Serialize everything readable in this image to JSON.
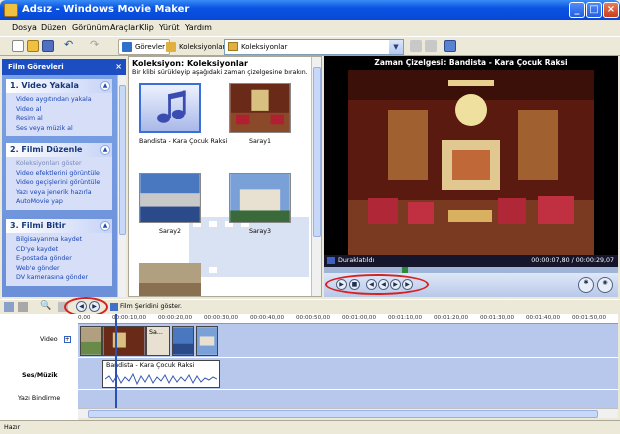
{
  "window": {
    "title": "Adsız - Windows Movie Maker"
  },
  "menu": [
    "Dosya",
    "Düzen",
    "Görünüm",
    "Araçlar",
    "Klip",
    "Yürüt",
    "Yardım"
  ],
  "toolbar": {
    "tasks_label": "Görevler",
    "collections_label": "Koleksiyonlar",
    "collections_combo": "Koleksiyonlar"
  },
  "taskpane": {
    "header": "Film Görevleri",
    "sections": [
      {
        "title": "1. Video Yakala",
        "items": [
          "Video aygıtından yakala",
          "Video al",
          "Resim al",
          "Ses veya müzik al"
        ]
      },
      {
        "title": "2. Filmi Düzenle",
        "items": [
          "Koleksiyonları göster",
          "Video efektlerini görüntüle",
          "Video geçişlerini görüntüle",
          "Yazı veya jenerik hazırla",
          "AutoMovie yap"
        ]
      },
      {
        "title": "3. Filmi Bitir",
        "items": [
          "Bilgisayarıma kaydet",
          "CD'ye kaydet",
          "E-postada gönder",
          "Web'e gönder",
          "DV kamerasına gönder"
        ]
      }
    ]
  },
  "collections": {
    "title": "Koleksiyon: Koleksiyonlar",
    "subtitle": "Bir klibi sürükleyip aşağıdaki zaman çizelgesine bırakın.",
    "clips": [
      "Bandista - Kara Çocuk Raksi",
      "Saray1",
      "Saray2",
      "Saray3"
    ]
  },
  "preview": {
    "title": "Zaman Çizelgesi: Bandista - Kara Çocuk Raksi",
    "status": "Duraklatıldı",
    "time": "00:00:07,80 / 00:00:29,07"
  },
  "timeline": {
    "show_storyboard": "Film Şeridini göster.",
    "ruler": [
      "0,00",
      "00:00:10,00",
      "00:00:20,00",
      "00:00:30,00",
      "00:00:40,00",
      "00:00:50,00",
      "00:01:00,00",
      "00:01:10,00",
      "00:01:20,00",
      "00:01:30,00",
      "00:01:40,00",
      "00:01:50,00"
    ],
    "tracks": {
      "video": "Video",
      "audio": "Ses/Müzik",
      "title_overlay": "Yazı Bindirme"
    },
    "video_clip_label": "Sa...",
    "audio_clip": "Bandista - Kara Çocuk Raksi"
  },
  "statusbar": {
    "text": "Hazır"
  }
}
